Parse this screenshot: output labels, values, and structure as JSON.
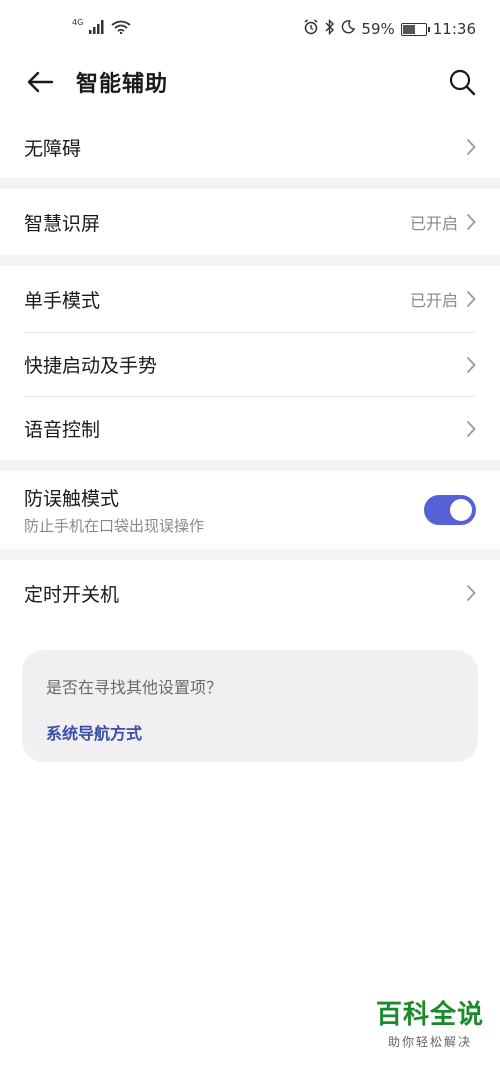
{
  "status_bar": {
    "network": "4G",
    "battery": "59%",
    "battery_level": 0.59,
    "time": "11:36"
  },
  "header": {
    "title": "智能辅助"
  },
  "items": {
    "accessibility": {
      "label": "无障碍"
    },
    "smart_screen": {
      "label": "智慧识屏",
      "value": "已开启"
    },
    "one_hand": {
      "label": "单手模式",
      "value": "已开启"
    },
    "shortcuts": {
      "label": "快捷启动及手势"
    },
    "voice": {
      "label": "语音控制"
    },
    "pocket_mode": {
      "label": "防误触模式",
      "sub": "防止手机在口袋出现误操作",
      "enabled": true
    },
    "schedule_power": {
      "label": "定时开关机"
    }
  },
  "suggest": {
    "title": "是否在寻找其他设置项？",
    "link": "系统导航方式"
  },
  "watermark": {
    "main": "百科全说",
    "sub": "助你轻松解决"
  },
  "colors": {
    "accent": "#5561d7",
    "link": "#3b4fa8",
    "separator": "#f5f2f5",
    "watermark": "#1b8a2b"
  }
}
